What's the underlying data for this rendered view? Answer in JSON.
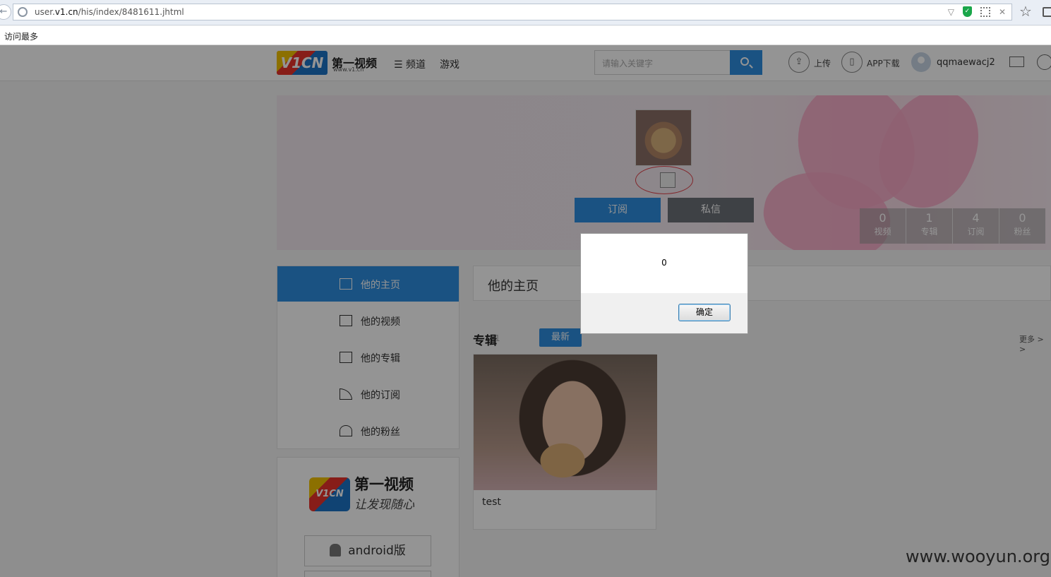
{
  "browser": {
    "url_prefix": "user.",
    "url_domain": "v1.cn",
    "url_path": "/his/index/8481611.jhtml",
    "bookmark": "访问最多"
  },
  "site": {
    "logo_mark": "V1CN",
    "logo_text": "第一视频",
    "logo_sub": "www.v1.cn",
    "nav": [
      "频道",
      "游戏"
    ],
    "search_placeholder": "请输入关键字",
    "upload_label": "上传",
    "app_download_label": "APP下载",
    "username": "qqmaewacj2"
  },
  "profile": {
    "subscribe_label": "订阅",
    "message_label": "私信",
    "stats": [
      {
        "value": "0",
        "label": "视频"
      },
      {
        "value": "1",
        "label": "专辑"
      },
      {
        "value": "4",
        "label": "订阅"
      },
      {
        "value": "0",
        "label": "粉丝"
      }
    ]
  },
  "sidebar": {
    "items": [
      {
        "label": "他的主页",
        "icon": "home-icon"
      },
      {
        "label": "他的视频",
        "icon": "video-icon"
      },
      {
        "label": "他的专辑",
        "icon": "album-grid-icon"
      },
      {
        "label": "他的订阅",
        "icon": "rss-icon"
      },
      {
        "label": "他的粉丝",
        "icon": "user-icon"
      }
    ]
  },
  "app_promo": {
    "logo_mark": "V1CN",
    "title": "第一视频",
    "slogan": "让发现随心",
    "android_label": "android版"
  },
  "main": {
    "title": "他的主页",
    "section_title": "专辑",
    "section_count": "1",
    "latest_label": "最新",
    "more_label": "更多 > >",
    "album_title": "test"
  },
  "dialog": {
    "message": "0",
    "ok_label": "确定"
  },
  "watermark": "www.wooyun.org"
}
